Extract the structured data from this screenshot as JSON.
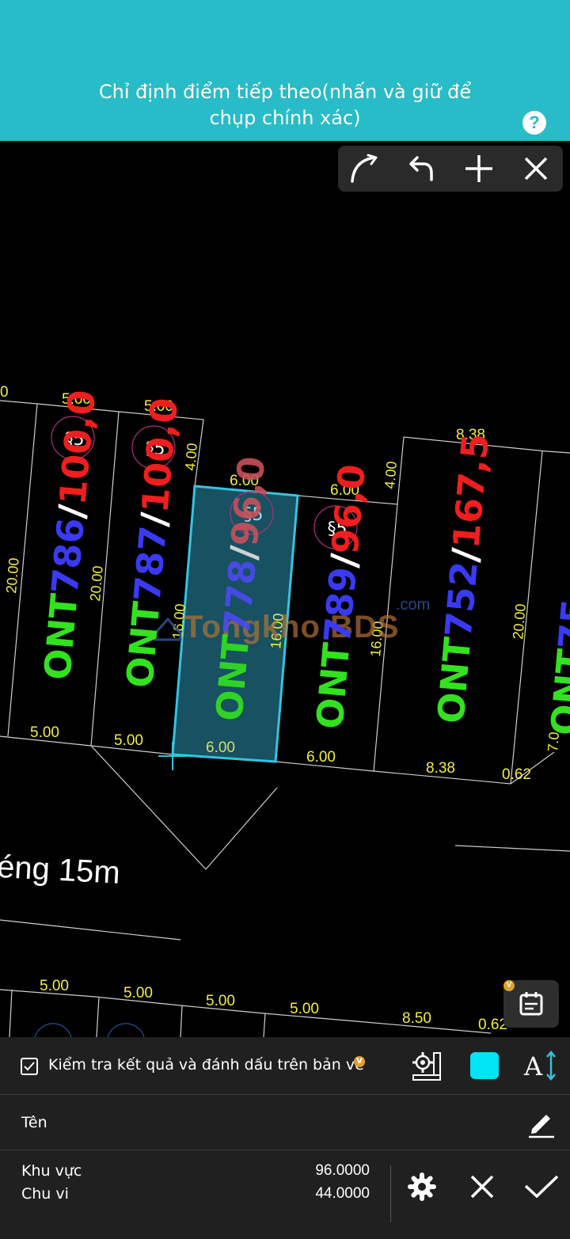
{
  "header": {
    "hint_line1": "Chỉ định điểm tiếp theo(nhấn và giữ để",
    "hint_line2": "chụp chính xác)",
    "help": "?",
    "accent": "#27bcc7"
  },
  "toolbar": {
    "icons": [
      "arc-icon",
      "undo-icon",
      "plus-icon",
      "close-icon"
    ]
  },
  "drawing": {
    "road_label": "éng 15m",
    "watermark": "Tongkho BDS",
    "watermark_com": ".com",
    "symbol": "§5",
    "lot_codes": [
      "ONT786",
      "ONT787",
      "ONT778",
      "ONT789",
      "ONT752",
      "ONT75"
    ],
    "lot_areas": [
      "100,0",
      "100,0",
      "96,0",
      "96,0",
      "167,5"
    ],
    "dims_top": [
      "0",
      "5.00",
      "5.00",
      "6.00",
      "6.00",
      "8.38"
    ],
    "dims_side": [
      "4.00",
      "4.00",
      "20.00",
      "20.00",
      "16.00",
      "16.00",
      "16.00",
      "20.00",
      "7.0"
    ],
    "dims_bottom": [
      "5.00",
      "5.00",
      "6.00",
      "6.00",
      "8.38",
      "0.62"
    ],
    "dims_lower": [
      "5.00",
      "5.00",
      "5.00",
      "5.00",
      "8.50",
      "0.62"
    ],
    "selection_color": "#2fb0c8"
  },
  "calendar_badge": "V",
  "panel": {
    "checkbox_label": "Kiểm tra kết quả và đánh dấu trên bản vẽ",
    "checkbox_badge": "V",
    "swatch_color": "#00e5f5",
    "name_label": "Tên",
    "area_label": "Khu vực",
    "area_value": "96.0000",
    "perimeter_label": "Chu vi",
    "perimeter_value": "44.0000"
  }
}
